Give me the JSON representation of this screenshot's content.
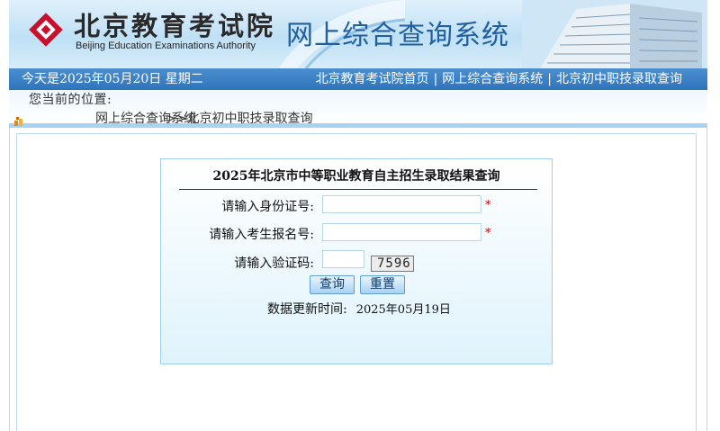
{
  "header": {
    "logo_cn": "北京教育考试院",
    "logo_en": "Beijing Education Examinations Authority",
    "site_title": "网上综合查询系统"
  },
  "navbar": {
    "date_text": "今天是2025年05月20日 星期二",
    "links": [
      {
        "label": "北京教育考试院首页"
      },
      {
        "label": "网上综合查询系统"
      },
      {
        "label": "北京初中职技录取查询"
      }
    ],
    "separator": "|"
  },
  "location": {
    "label": "您当前的位置:",
    "home_link": "网上综合查询系统",
    "current": ">>北京初中职技录取查询"
  },
  "query": {
    "title": "2025年北京市中等职业教育自主招生录取结果查询",
    "fields": [
      {
        "label": "请输入身份证号:",
        "value": "",
        "required_mark": "*"
      },
      {
        "label": "请输入考生报名号:",
        "value": "",
        "required_mark": "*"
      },
      {
        "label": "请输入验证码:",
        "value": ""
      }
    ],
    "captcha_text": "7596",
    "buttons": {
      "search": "查询",
      "reset": "重置"
    },
    "update_label": "数据更新时间:",
    "update_date": "2025年05月19日"
  },
  "colors": {
    "nav_blue": "#2f74bb",
    "title_blue": "#1f5f9e",
    "logo_red": "#c8102e",
    "box_border": "#9fd0ef",
    "required_red": "#d40000"
  }
}
